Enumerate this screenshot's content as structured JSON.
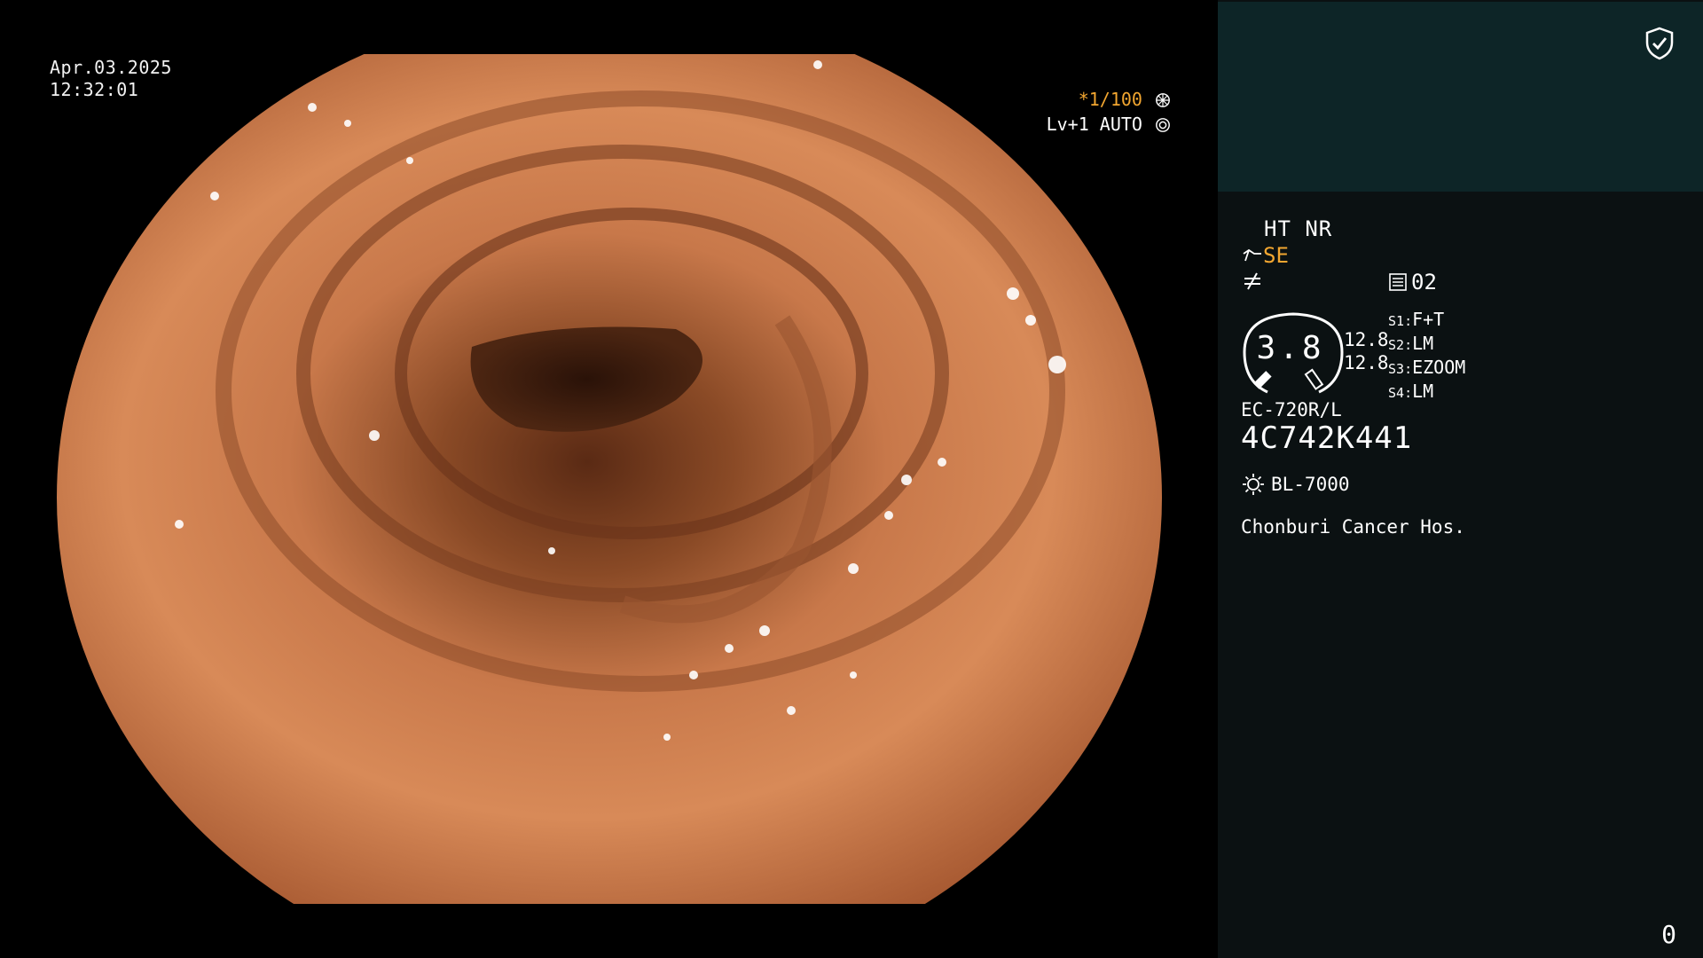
{
  "overlay": {
    "date": "Apr.03.2025",
    "time": "12:32:01",
    "shutter": "*1/100",
    "shutter_icon": "aperture-icon",
    "level": "Lv+1 AUTO",
    "level_icon": "iris-icon"
  },
  "panel": {
    "shield_icon": "shield-check-icon",
    "enhancement": "HT NR",
    "structure_mode": "SE",
    "structure_icon": "scope-tip-icon",
    "freeze_icon": "not-equal-icon",
    "memory_icon": "document-icon",
    "memory_value": "02",
    "gauge_value": "3.8",
    "pressures": [
      "12.8",
      "12.8"
    ],
    "switches": [
      {
        "key": "S1",
        "value": "F+T"
      },
      {
        "key": "S2",
        "value": "LM"
      },
      {
        "key": "S3",
        "value": "EZOOM"
      },
      {
        "key": "S4",
        "value": "LM"
      }
    ],
    "scope_model": "EC-720R/L",
    "scope_serial": "4C742K441",
    "light_icon": "sun-icon",
    "light_source": "BL-7000",
    "hospital": "Chonburi Cancer Hos.",
    "counter": "0"
  },
  "colors": {
    "shutter": "#f2a630",
    "panel_bg": "#0b1112",
    "panel_header_bg": "#0d2527",
    "tissue": "#c97a4a"
  }
}
